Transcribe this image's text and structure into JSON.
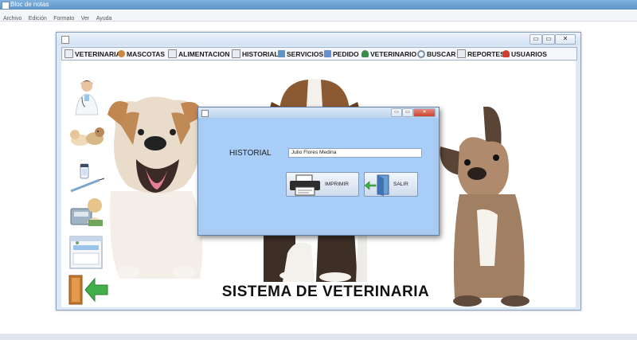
{
  "notepad": {
    "title": "Bloc de notas",
    "menu": [
      "Archivo",
      "Edición",
      "Formato",
      "Ver",
      "Ayuda"
    ]
  },
  "app": {
    "controls": {
      "minimize": "▭",
      "maximize": "▭",
      "close": "✕"
    },
    "menu": [
      {
        "label": "VETERINARIA",
        "icon": "document-icon"
      },
      {
        "label": "MASCOTAS",
        "icon": "paw-icon"
      },
      {
        "label": "ALIMENTACION",
        "icon": "document-icon"
      },
      {
        "label": "HISTORIAL",
        "icon": "document-icon"
      },
      {
        "label": "SERVICIOS",
        "icon": "tray-icon"
      },
      {
        "label": "PEDIDO",
        "icon": "clipboard-icon"
      },
      {
        "label": "VETERINARIO",
        "icon": "person-icon"
      },
      {
        "label": "BUSCAR",
        "icon": "magnifier-icon"
      },
      {
        "label": "REPORTES",
        "icon": "document-icon"
      },
      {
        "label": "USUARIOS",
        "icon": "user-red-icon"
      }
    ],
    "footer_title": "SISTEMA DE VETERINARIA"
  },
  "dialog": {
    "label": "HISTORIAL",
    "input_value": "Julio Flores Medina",
    "print_label": "IMPRIMIR",
    "exit_label": "SALIR"
  },
  "colors": {
    "dialog_bg": "#a7cdf8",
    "menubar_bg": "#f4f6f9",
    "title_bar": "#5d95c8"
  }
}
